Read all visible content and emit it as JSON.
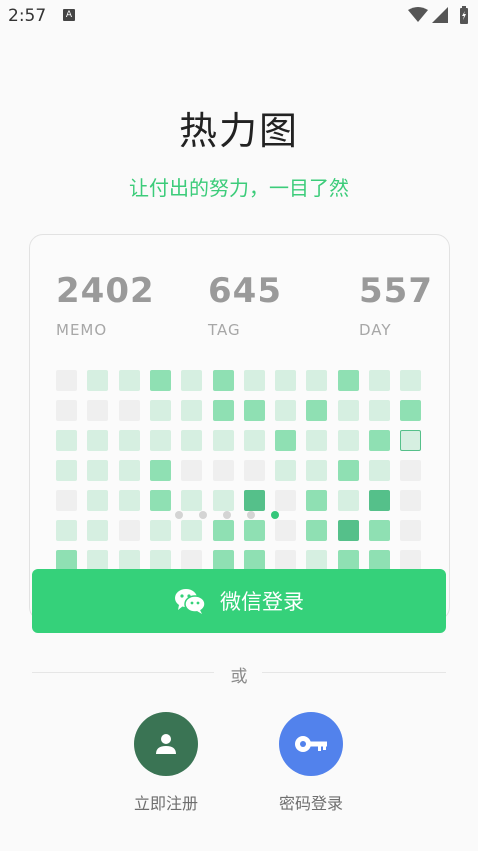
{
  "status_bar": {
    "time": "2:57",
    "notification_glyph": "A"
  },
  "header": {
    "title": "热力图",
    "subtitle": "让付出的努力，一目了然"
  },
  "stats": [
    {
      "value": "2402",
      "label": "MEMO"
    },
    {
      "value": "645",
      "label": "TAG"
    },
    {
      "value": "557",
      "label": "DAY"
    }
  ],
  "heatmap": {
    "columns": 12,
    "rows": 7,
    "colors": {
      "0": "#efefef",
      "1": "#d6efe1",
      "2": "#8fe0b3",
      "3": "#55c08a",
      "outline": "#d6efe1"
    },
    "levels": [
      [
        0,
        1,
        1,
        2,
        1,
        2,
        1,
        1,
        1,
        2,
        1,
        1
      ],
      [
        0,
        0,
        0,
        1,
        1,
        2,
        2,
        1,
        2,
        1,
        1,
        2
      ],
      [
        1,
        1,
        1,
        1,
        1,
        1,
        1,
        2,
        1,
        1,
        2,
        "outline"
      ],
      [
        1,
        1,
        1,
        2,
        0,
        0,
        0,
        1,
        1,
        2,
        1,
        0
      ],
      [
        0,
        1,
        1,
        2,
        1,
        1,
        3,
        0,
        2,
        1,
        3,
        0
      ],
      [
        1,
        1,
        0,
        1,
        1,
        2,
        2,
        0,
        2,
        3,
        2,
        0
      ],
      [
        2,
        1,
        1,
        1,
        0,
        2,
        2,
        0,
        1,
        2,
        2,
        0
      ]
    ]
  },
  "pager": {
    "count": 5,
    "active": 4
  },
  "wechat_login": {
    "label": "微信登录",
    "icon": "wechat-icon"
  },
  "divider": {
    "label": "或"
  },
  "register": {
    "label": "立即注册",
    "icon": "user-icon",
    "color": "#3a7454"
  },
  "password_login": {
    "label": "密码登录",
    "icon": "key-icon",
    "color": "#5282ec"
  },
  "colors": {
    "accent": "#35d17a",
    "subtitle": "#3ccc7a"
  }
}
